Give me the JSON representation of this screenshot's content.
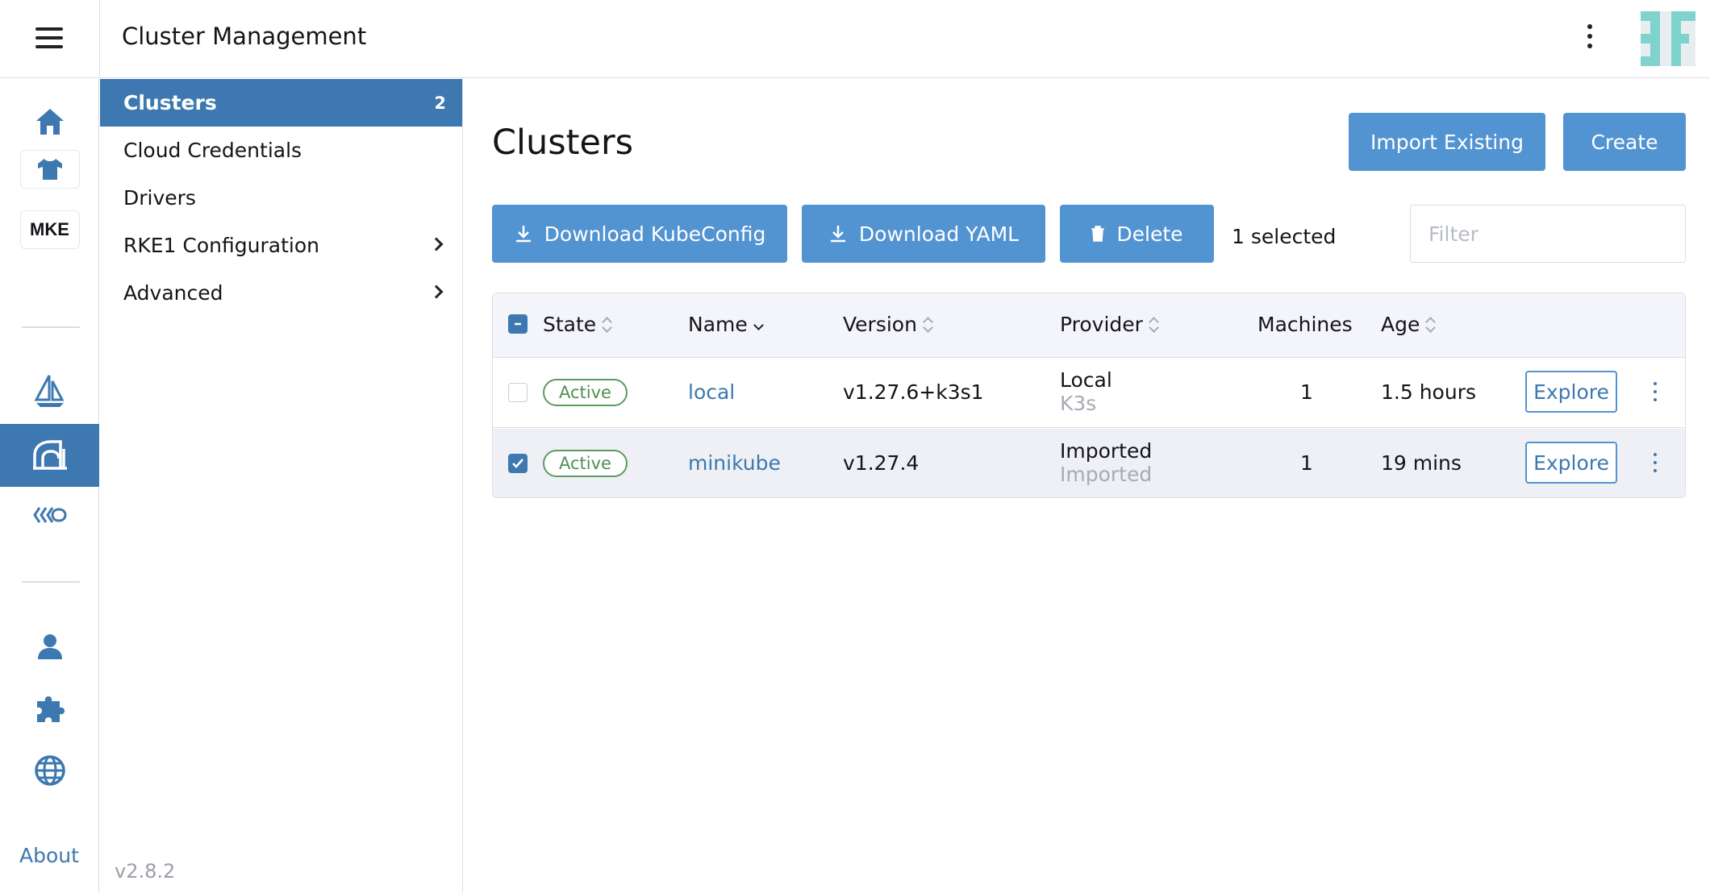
{
  "header": {
    "title": "Cluster Management",
    "menu_icon": "hamburger-icon",
    "more_icon": "kebab-icon",
    "avatar_icon": "user-avatar"
  },
  "rail": {
    "items": [
      {
        "icon": "home-icon"
      },
      {
        "icon": "shirt-icon"
      },
      {
        "label": "MKE"
      },
      {
        "icon": "sailboat-icon"
      },
      {
        "icon": "cluster-management-icon",
        "active": true
      },
      {
        "icon": "fleet-icon"
      },
      {
        "icon": "user-icon"
      },
      {
        "icon": "extensions-puzzle-icon"
      },
      {
        "icon": "globe-icon"
      }
    ],
    "about": "About"
  },
  "sidenav": {
    "items": [
      {
        "label": "Clusters",
        "count": "2",
        "active": true
      },
      {
        "label": "Cloud Credentials"
      },
      {
        "label": "Drivers"
      },
      {
        "label": "RKE1 Configuration",
        "expandable": true
      },
      {
        "label": "Advanced",
        "expandable": true
      }
    ],
    "version": "v2.8.2"
  },
  "main": {
    "title": "Clusters",
    "import_button": "Import Existing",
    "create_button": "Create",
    "download_kubeconfig": "Download KubeConfig",
    "download_yaml": "Download YAML",
    "delete": "Delete",
    "selected_count": "1 selected",
    "filter_placeholder": "Filter"
  },
  "table": {
    "columns": [
      "State",
      "Name",
      "Version",
      "Provider",
      "Machines",
      "Age"
    ],
    "rows": [
      {
        "selected": false,
        "state": "Active",
        "name": "local",
        "version": "v1.27.6+k3s1",
        "provider": "Local",
        "provider_sub": "K3s",
        "machines": "1",
        "age": "1.5 hours",
        "action": "Explore"
      },
      {
        "selected": true,
        "state": "Active",
        "name": "minikube",
        "version": "v1.27.4",
        "provider": "Imported",
        "provider_sub": "Imported",
        "machines": "1",
        "age": "19 mins",
        "action": "Explore"
      }
    ]
  },
  "colors": {
    "primary": "#3d78b0",
    "button": "#5293d2",
    "active_badge": "#5c9b5e",
    "avatar": "#7fd3cc"
  }
}
